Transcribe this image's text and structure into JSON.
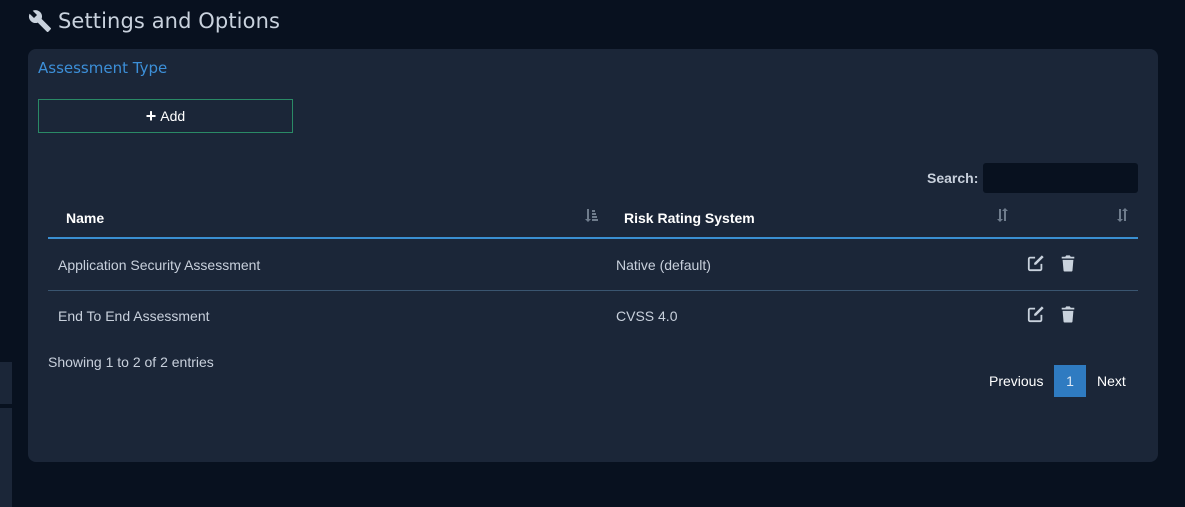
{
  "header": {
    "title": "Settings and Options",
    "icon": "wrench-icon"
  },
  "panel": {
    "title": "Assessment Type",
    "add_button_label": "Add",
    "add_button_icon": "plus-icon"
  },
  "search": {
    "label": "Search:",
    "value": ""
  },
  "table": {
    "columns": [
      "Name",
      "Risk Rating System",
      ""
    ],
    "rows": [
      {
        "name": "Application Security Assessment",
        "risk_rating_system": "Native (default)"
      },
      {
        "name": "End To End Assessment",
        "risk_rating_system": "CVSS 4.0"
      }
    ],
    "row_action_icons": [
      "edit-icon",
      "trash-icon"
    ]
  },
  "footer": {
    "info": "Showing 1 to 2 of 2 entries",
    "previous_label": "Previous",
    "current_page": "1",
    "next_label": "Next"
  },
  "colors": {
    "page_background": "#08111f",
    "panel_background": "#1b2638",
    "accent_blue": "#3c8fd8",
    "add_border_green": "#2a8a66",
    "active_page": "#2f7bc1"
  }
}
